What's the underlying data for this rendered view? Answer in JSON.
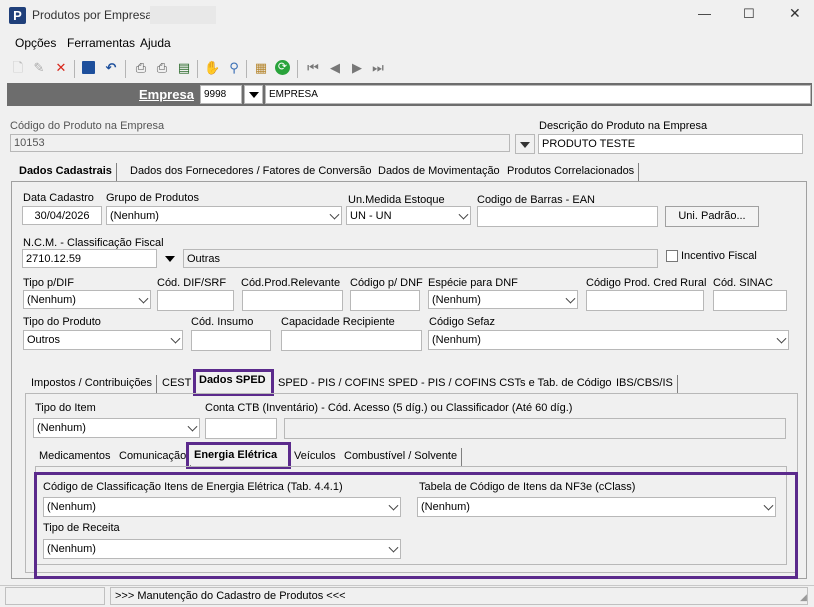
{
  "window": {
    "title": "Produtos por Empresa",
    "controls": [
      "—",
      "☐",
      "✕"
    ]
  },
  "menu": [
    "Opções",
    "Ferramentas",
    "Ajuda"
  ],
  "empresa": {
    "label": "Empresa",
    "code": "9998",
    "name": "EMPRESA"
  },
  "codigo": {
    "label": "Código do Produto na Empresa",
    "value": "10153"
  },
  "descricao": {
    "label": "Descrição do Produto na Empresa",
    "value": "PRODUTO TESTE"
  },
  "main_tabs": [
    "Dados Cadastrais",
    "Dados dos Fornecedores / Fatores de Conversão",
    "Dados de Movimentação",
    "Produtos Correlacionados"
  ],
  "cad": {
    "data_label": "Data Cadastro",
    "data_value": "30/04/2026",
    "grupo_label": "Grupo de Produtos",
    "grupo_value": "(Nenhum)",
    "un_label": "Un.Medida Estoque",
    "un_value": "UN - UN",
    "ean_label": "Codigo de Barras - EAN",
    "ean_value": "",
    "uni_button": "Uni. Padrão...",
    "ncm_label": "N.C.M. -  Classificação Fiscal",
    "ncm_value": "2710.12.59",
    "ncm_desc": "Outras",
    "incentivo_label": "Incentivo Fiscal",
    "dif_label": "Tipo p/DIF",
    "dif_value": "(Nenhum)",
    "difsrf_label": "Cód. DIF/SRF",
    "relevante_label": "Cód.Prod.Relevante",
    "dnf_label": "Código p/ DNF",
    "especie_label": "Espécie para DNF",
    "especie_value": "(Nenhum)",
    "credrural_label": "Código Prod. Cred Rural",
    "sinac_label": "Cód. SINAC",
    "tipo_label": "Tipo do Produto",
    "tipo_value": "Outros",
    "insumo_label": "Cód. Insumo",
    "capacidade_label": "Capacidade Recipiente",
    "sefaz_label": "Código Sefaz",
    "sefaz_value": "(Nenhum)"
  },
  "sub_tabs": [
    "Impostos / Contribuições",
    "CEST",
    "Dados SPED",
    "SPED - PIS / COFINS",
    "SPED - PIS / COFINS CSTs e Tab. de Códigos",
    "IBS/CBS/IS"
  ],
  "sped": {
    "tipo_item_label": "Tipo do Item",
    "tipo_item_value": "(Nenhum)",
    "conta_label": "Conta CTB (Inventário) - Cód. Acesso (5 díg.) ou Classificador (Até 60 díg.)"
  },
  "sped_tabs": [
    "Medicamentos",
    "Comunicação",
    "Energia Elétrica",
    "Veículos",
    "Combustível / Solvente"
  ],
  "energia": {
    "class_label": "Código de Classificação Itens de Energia Elétrica (Tab. 4.4.1)",
    "class_value": "(Nenhum)",
    "nf3e_label": "Tabela de Código de Itens da NF3e (cClass)",
    "nf3e_value": "(Nenhum)",
    "receita_label": "Tipo de Receita",
    "receita_value": "(Nenhum)"
  },
  "status": {
    "message": ">>> Manutenção do Cadastro de Produtos <<<"
  },
  "colors": {
    "highlight": "#5b2a8c",
    "header_bar": "#6d6d6d"
  }
}
